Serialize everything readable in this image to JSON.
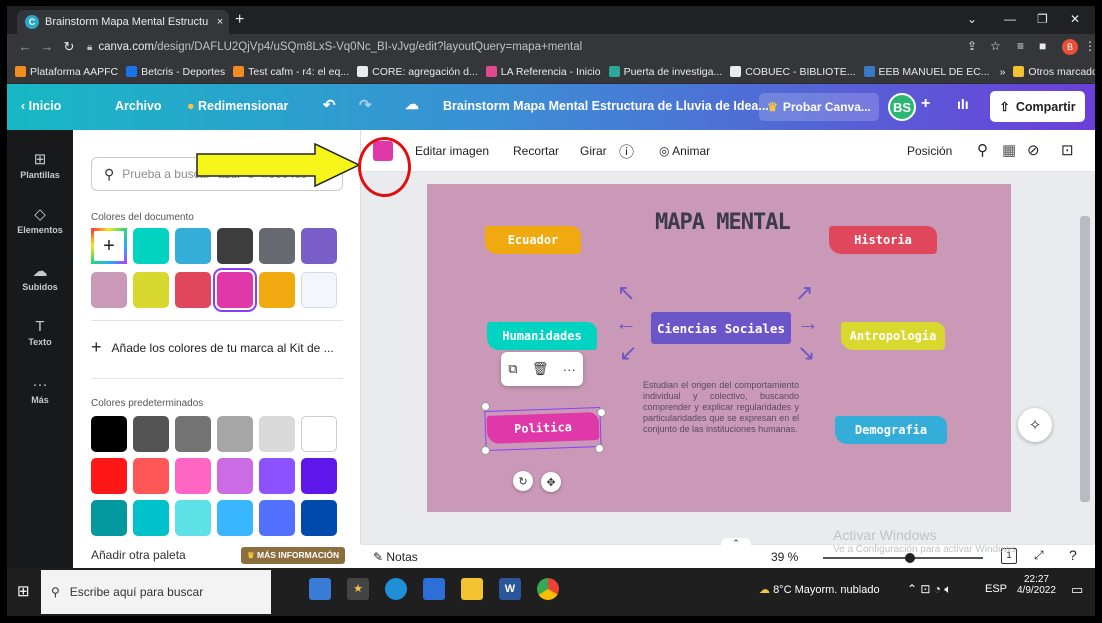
{
  "browser": {
    "tab_title": "Brainstorm Mapa Mental Estructu",
    "tab_close": "×",
    "new_tab": "+",
    "url_domain": "canva.com",
    "url_path": "/design/DAFLU2QjVp4/uSQm8LxS-Vq0Nc_BI-vJvg/edit?layoutQuery=mapa+mental",
    "profile_initial": "B",
    "bookmarks": [
      {
        "label": "Plataforma AAPFC",
        "color": "#f28b20"
      },
      {
        "label": "Betcris - Deportes",
        "color": "#1a73e8"
      },
      {
        "label": "Test cafm - r4: el eq...",
        "color": "#f28b20"
      },
      {
        "label": "CORE: agregación d...",
        "color": "#e8eaed"
      },
      {
        "label": "LA Referencia - Inicio",
        "color": "#e04a8a"
      },
      {
        "label": "Puerta de investiga...",
        "color": "#2aa89a"
      },
      {
        "label": "COBUEC - BIBLIOTE...",
        "color": "#e8eaed"
      },
      {
        "label": "EEB MANUEL DE EC...",
        "color": "#3a78c8"
      }
    ],
    "bookmarks_more": "»",
    "other_bookmarks": "Otros marcadores"
  },
  "canva_top": {
    "home": "Inicio",
    "file": "Archivo",
    "resize": "Redimensionar",
    "doc_title": "Brainstorm Mapa Mental Estructura de Lluvia de Idea...",
    "try_pro": "Probar Canva...",
    "user_initials": "BS",
    "add_user": "+",
    "share": "Compartir"
  },
  "rail": [
    {
      "label": "Plantillas",
      "glyph": "⊞"
    },
    {
      "label": "Elementos",
      "glyph": "◇"
    },
    {
      "label": "Subidos",
      "glyph": "☁"
    },
    {
      "label": "Texto",
      "glyph": "T"
    },
    {
      "label": "Más",
      "glyph": "···"
    }
  ],
  "panel": {
    "search_placeholder": "Prueba a buscar \"azul\" o \"#00c4cc\"",
    "doc_colors_label": "Colores del documento",
    "doc_colors": [
      "#00d4c0",
      "#34aed8",
      "#3d3d3d",
      "#666a70",
      "#7a5ec8",
      "#c999b7",
      "#d8d82e",
      "#e0465c",
      "#e038a8",
      "#f0aa10",
      "#f3f7fb"
    ],
    "add_brand": "Añade los colores de tu marca al Kit de ...",
    "default_colors_label": "Colores predeterminados",
    "default_colors": [
      "#000000",
      "#545454",
      "#737373",
      "#a6a6a6",
      "#d9d9d9",
      "#ffffff",
      "#ff1616",
      "#ff5757",
      "#ff66c4",
      "#cb6ce6",
      "#8c52ff",
      "#5e17eb",
      "#03989e",
      "#00c2cb",
      "#5ce1e6",
      "#38b6ff",
      "#5271ff",
      "#004aad"
    ],
    "add_palette": "Añadir otra paleta",
    "more_info": "MÁS INFORMACIÓN"
  },
  "context_bar": {
    "color_value": "#e038a8",
    "edit_image": "Editar imagen",
    "crop": "Recortar",
    "rotate": "Girar",
    "animate": "Animar",
    "position": "Posición"
  },
  "mindmap": {
    "title": "MAPA MENTAL",
    "center": "Ciencias Sociales",
    "nodes": [
      {
        "label": "Ecuador",
        "color": "#f0aa10"
      },
      {
        "label": "Historia",
        "color": "#e0465c"
      },
      {
        "label": "Humanidades",
        "color": "#00d4c0"
      },
      {
        "label": "Antropologia",
        "color": "#d8d82e"
      },
      {
        "label": "Politica",
        "color": "#e038a8"
      },
      {
        "label": "Demografia",
        "color": "#34aed8"
      }
    ],
    "description": "Estudian el origen del comportamiento individual y colectivo, buscando comprender y explicar regularidades y particularidades que se expresan en el conjunto de las instituciones humanas."
  },
  "bottom_bar": {
    "notes": "Notas",
    "zoom": "39 %",
    "zoom_fraction": 0.39,
    "page_number": "1",
    "activate_title": "Activar Windows",
    "activate_sub": "Ve a Configuración para activar Windows."
  },
  "taskbar": {
    "search": "Escribe aquí para buscar",
    "weather": "8°C Mayorm. nublado",
    "lang": "ESP",
    "time": "22:27",
    "date": "4/9/2022"
  }
}
